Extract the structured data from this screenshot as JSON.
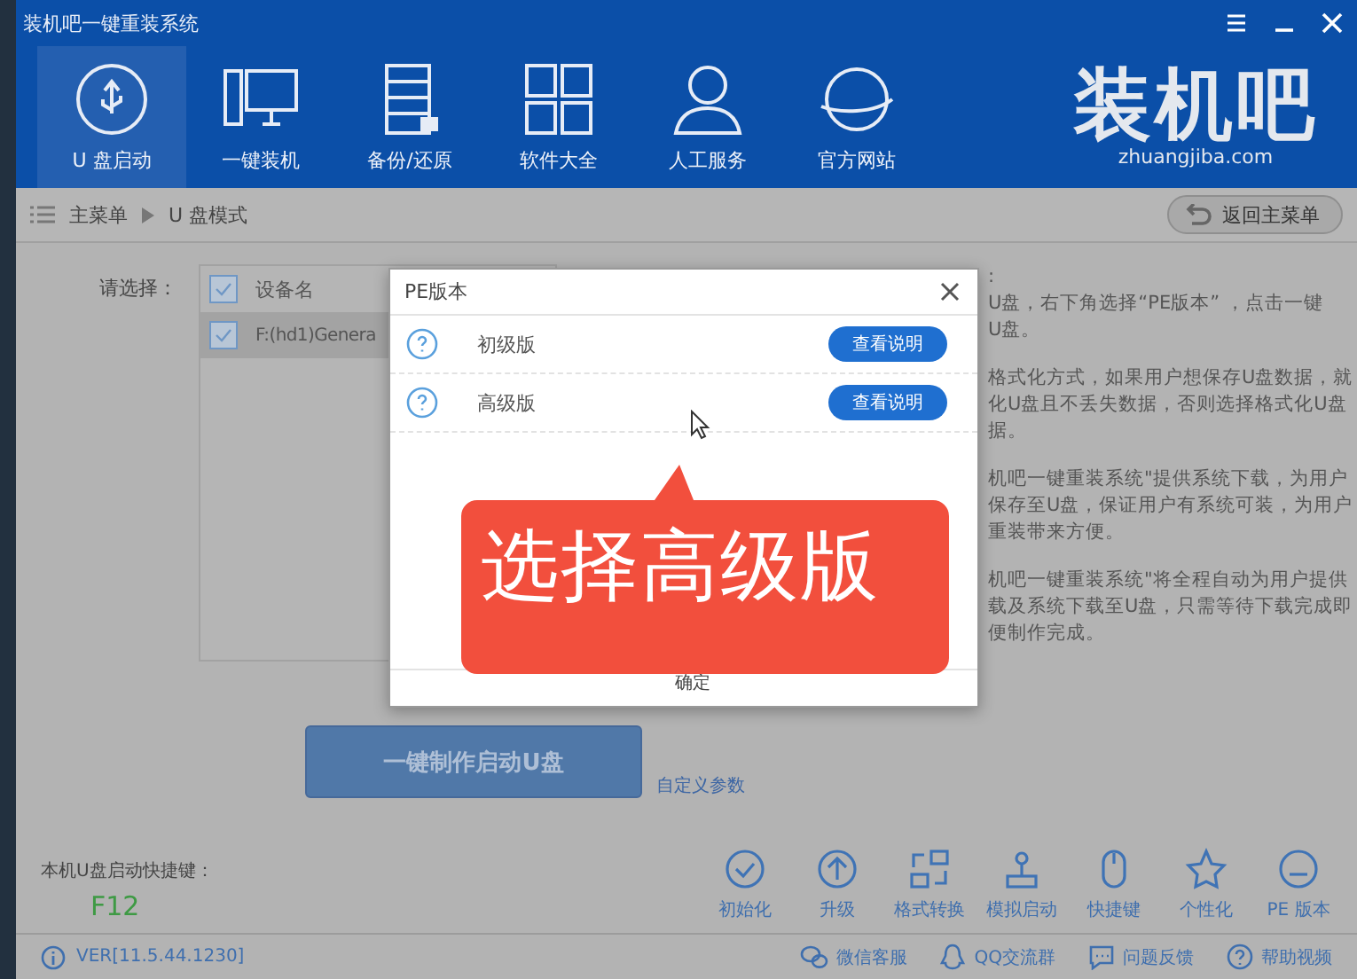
{
  "window": {
    "title": "装机吧一键重装系统"
  },
  "nav": [
    {
      "label": "U 盘启动",
      "selected": true
    },
    {
      "label": "一键装机",
      "selected": false
    },
    {
      "label": "备份/还原",
      "selected": false
    },
    {
      "label": "软件大全",
      "selected": false
    },
    {
      "label": "人工服务",
      "selected": false
    },
    {
      "label": "官方网站",
      "selected": false
    }
  ],
  "logo": {
    "name": "装机吧",
    "url": "zhuangjiba.com"
  },
  "breadcrumb": [
    "主菜单",
    "U 盘模式"
  ],
  "back_button": "返回主菜单",
  "select_label": "请选择：",
  "device_table": {
    "header_checked": true,
    "column": "设备名",
    "rows": [
      {
        "name": "F:(hd1)Genera",
        "checked": true,
        "selected": true
      }
    ]
  },
  "info_lines": [
    ":",
    "U盘，右下角选择“PE版本” ，点击一键",
    "U盘。",
    "格式化方式，如果用户想保存U盘数据，就",
    "化U盘且不丢失数据，否则选择格式化U盘",
    "据。",
    "机吧一键重装系统\"提供系统下载，为用户",
    "保存至U盘，保证用户有系统可装，为用户",
    "重装带来方便。",
    "机吧一键重装系统\"将全程自动为用户提供",
    "载及系统下载至U盘，只需等待下载完成即",
    "便制作完成。"
  ],
  "dialog": {
    "title": "PE版本",
    "options": [
      {
        "label": "初级版",
        "button": "查看说明"
      },
      {
        "label": "高级版",
        "button": "查看说明"
      }
    ],
    "confirm": "确定"
  },
  "callout": "选择高级版",
  "make_button": "一键制作启动U盘",
  "custom_link": "自定义参数",
  "hotkey": {
    "label": "本机U盘启动快捷键：",
    "key": "F12"
  },
  "tools": [
    "初始化",
    "升级",
    "格式转换",
    "模拟启动",
    "快捷键",
    "个性化",
    "PE 版本"
  ],
  "status_bar": {
    "version": "VER[11.5.44.1230]",
    "links": [
      "微信客服",
      "QQ交流群",
      "问题反馈",
      "帮助视频"
    ]
  }
}
